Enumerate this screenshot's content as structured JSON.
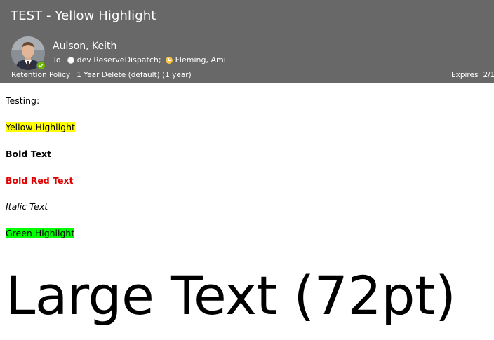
{
  "message": {
    "subject": "TEST - Yellow Highlight",
    "sender": "Aulson, Keith",
    "to_label": "To",
    "recipients": [
      {
        "name": "dev ReserveDispatch;",
        "status": "offline"
      },
      {
        "name": "Fleming, Ami",
        "status": "away"
      }
    ],
    "retention_label": "Retention Policy",
    "retention_value": "1 Year Delete (default) (1 year)",
    "expires_label": "Expires",
    "expires_value": "2/1"
  },
  "body": {
    "intro": "Testing:",
    "yellow_highlight": "Yellow Highlight",
    "bold_text": "Bold Text",
    "bold_red_text": "Bold Red Text",
    "italic_text": "Italic Text",
    "green_highlight": "Green Highlight",
    "large_text": "Large Text (72pt)"
  },
  "colors": {
    "header_bg": "#686868",
    "yellow_highlight": "#ffff00",
    "green_highlight": "#00ff00",
    "red_text": "#e00000",
    "presence_available": "#6bb700",
    "presence_away": "#f8c444"
  },
  "icons": {
    "presence": "available-check-icon",
    "recipient_1_status": "offline-status-icon",
    "recipient_2_status": "away-clock-icon"
  }
}
